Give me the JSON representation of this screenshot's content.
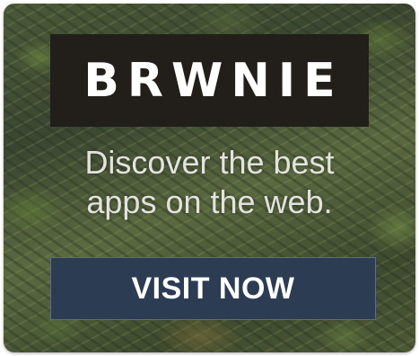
{
  "ad": {
    "brand": "BRWNIE",
    "tagline_line1": "Discover the best",
    "tagline_line2": "apps on the web.",
    "cta_label": "VISIT NOW",
    "colors": {
      "brand_box": "#221f1b",
      "brand_text": "#ffffff",
      "tagline_text": "#e2e2de",
      "cta_background": "#2c3c52",
      "cta_text": "#ffffff"
    }
  }
}
